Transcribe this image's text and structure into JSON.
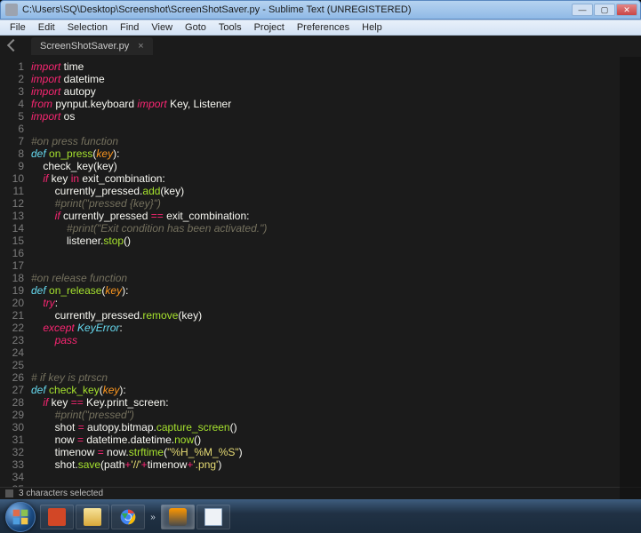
{
  "window": {
    "title": "C:\\Users\\SQ\\Desktop\\Screenshot\\ScreenShotSaver.py - Sublime Text (UNREGISTERED)",
    "min": "—",
    "max": "▢",
    "close": "✕"
  },
  "menu": {
    "items": [
      "File",
      "Edit",
      "Selection",
      "Find",
      "View",
      "Goto",
      "Tools",
      "Project",
      "Preferences",
      "Help"
    ]
  },
  "tab": {
    "name": "ScreenShotSaver.py",
    "close": "×"
  },
  "status": {
    "text": "3 characters selected"
  },
  "code": {
    "lines": [
      [
        [
          "kw",
          "import"
        ],
        [
          "pl",
          " time"
        ]
      ],
      [
        [
          "kw",
          "import"
        ],
        [
          "pl",
          " datetime"
        ]
      ],
      [
        [
          "kw",
          "import"
        ],
        [
          "pl",
          " autopy"
        ]
      ],
      [
        [
          "kw",
          "from"
        ],
        [
          "pl",
          " pynput.keyboard "
        ],
        [
          "kw",
          "import"
        ],
        [
          "pl",
          " Key, Listener"
        ]
      ],
      [
        [
          "kw",
          "import"
        ],
        [
          "pl",
          " os"
        ]
      ],
      [],
      [
        [
          "cm",
          "#on press function"
        ]
      ],
      [
        [
          "kw2",
          "def"
        ],
        [
          "pl",
          " "
        ],
        [
          "fn",
          "on_press"
        ],
        [
          "pl",
          "("
        ],
        [
          "arg",
          "key"
        ],
        [
          "pl",
          "):"
        ]
      ],
      [
        [
          "pl",
          "    "
        ],
        [
          "pl",
          "check_key(key)"
        ]
      ],
      [
        [
          "pl",
          "    "
        ],
        [
          "kw",
          "if"
        ],
        [
          "pl",
          " key "
        ],
        [
          "op",
          "in"
        ],
        [
          "pl",
          " exit_combination:"
        ]
      ],
      [
        [
          "pl",
          "        currently_pressed."
        ],
        [
          "meth",
          "add"
        ],
        [
          "pl",
          "(key)"
        ]
      ],
      [
        [
          "pl",
          "        "
        ],
        [
          "cm",
          "#print(\"pressed {key}\")"
        ]
      ],
      [
        [
          "pl",
          "        "
        ],
        [
          "kw",
          "if"
        ],
        [
          "pl",
          " currently_pressed "
        ],
        [
          "op",
          "=="
        ],
        [
          "pl",
          " exit_combination:"
        ]
      ],
      [
        [
          "pl",
          "            "
        ],
        [
          "cm",
          "#print(\"Exit condition has been activated.\")"
        ]
      ],
      [
        [
          "pl",
          "            listener."
        ],
        [
          "meth",
          "stop"
        ],
        [
          "pl",
          "()"
        ]
      ],
      [],
      [],
      [
        [
          "cm",
          "#on release function"
        ]
      ],
      [
        [
          "kw2",
          "def"
        ],
        [
          "pl",
          " "
        ],
        [
          "fn",
          "on_release"
        ],
        [
          "pl",
          "("
        ],
        [
          "arg",
          "key"
        ],
        [
          "pl",
          "):"
        ]
      ],
      [
        [
          "pl",
          "    "
        ],
        [
          "kw",
          "try"
        ],
        [
          "pl",
          ":"
        ]
      ],
      [
        [
          "pl",
          "        currently_pressed."
        ],
        [
          "meth",
          "remove"
        ],
        [
          "pl",
          "(key)"
        ]
      ],
      [
        [
          "pl",
          "    "
        ],
        [
          "kw",
          "except"
        ],
        [
          "pl",
          " "
        ],
        [
          "kw2",
          "KeyError"
        ],
        [
          "pl",
          ":"
        ]
      ],
      [
        [
          "pl",
          "        "
        ],
        [
          "kw",
          "pass"
        ]
      ],
      [],
      [],
      [
        [
          "cm",
          "# if key is ptrscn"
        ]
      ],
      [
        [
          "kw2",
          "def"
        ],
        [
          "pl",
          " "
        ],
        [
          "fn",
          "check_key"
        ],
        [
          "pl",
          "("
        ],
        [
          "arg",
          "key"
        ],
        [
          "pl",
          "):"
        ]
      ],
      [
        [
          "pl",
          "    "
        ],
        [
          "kw",
          "if"
        ],
        [
          "pl",
          " key "
        ],
        [
          "op",
          "=="
        ],
        [
          "pl",
          " Key.print_screen:"
        ]
      ],
      [
        [
          "pl",
          "        "
        ],
        [
          "cm",
          "#print(\"pressed\")"
        ]
      ],
      [
        [
          "pl",
          "        shot "
        ],
        [
          "op",
          "="
        ],
        [
          "pl",
          " autopy.bitmap."
        ],
        [
          "meth",
          "capture_screen"
        ],
        [
          "pl",
          "()"
        ]
      ],
      [
        [
          "pl",
          "        now "
        ],
        [
          "op",
          "="
        ],
        [
          "pl",
          " datetime.datetime."
        ],
        [
          "meth",
          "now"
        ],
        [
          "pl",
          "()"
        ]
      ],
      [
        [
          "pl",
          "        timenow "
        ],
        [
          "op",
          "="
        ],
        [
          "pl",
          " now."
        ],
        [
          "meth",
          "strftime"
        ],
        [
          "pl",
          "("
        ],
        [
          "str",
          "\"%H_%M_%S\""
        ],
        [
          "pl",
          ")"
        ]
      ],
      [
        [
          "pl",
          "        shot."
        ],
        [
          "meth",
          "save"
        ],
        [
          "pl",
          "(path"
        ],
        [
          "op",
          "+"
        ],
        [
          "str",
          "'//'"
        ],
        [
          "op",
          "+"
        ],
        [
          "pl",
          "timenow"
        ],
        [
          "op",
          "+"
        ],
        [
          "str",
          "'.png'"
        ],
        [
          "pl",
          ")"
        ]
      ],
      [],
      []
    ]
  },
  "taskbar": {
    "items": [
      "powerpoint",
      "explorer",
      "chrome",
      "chevrons",
      "sublime",
      "notepad"
    ]
  }
}
